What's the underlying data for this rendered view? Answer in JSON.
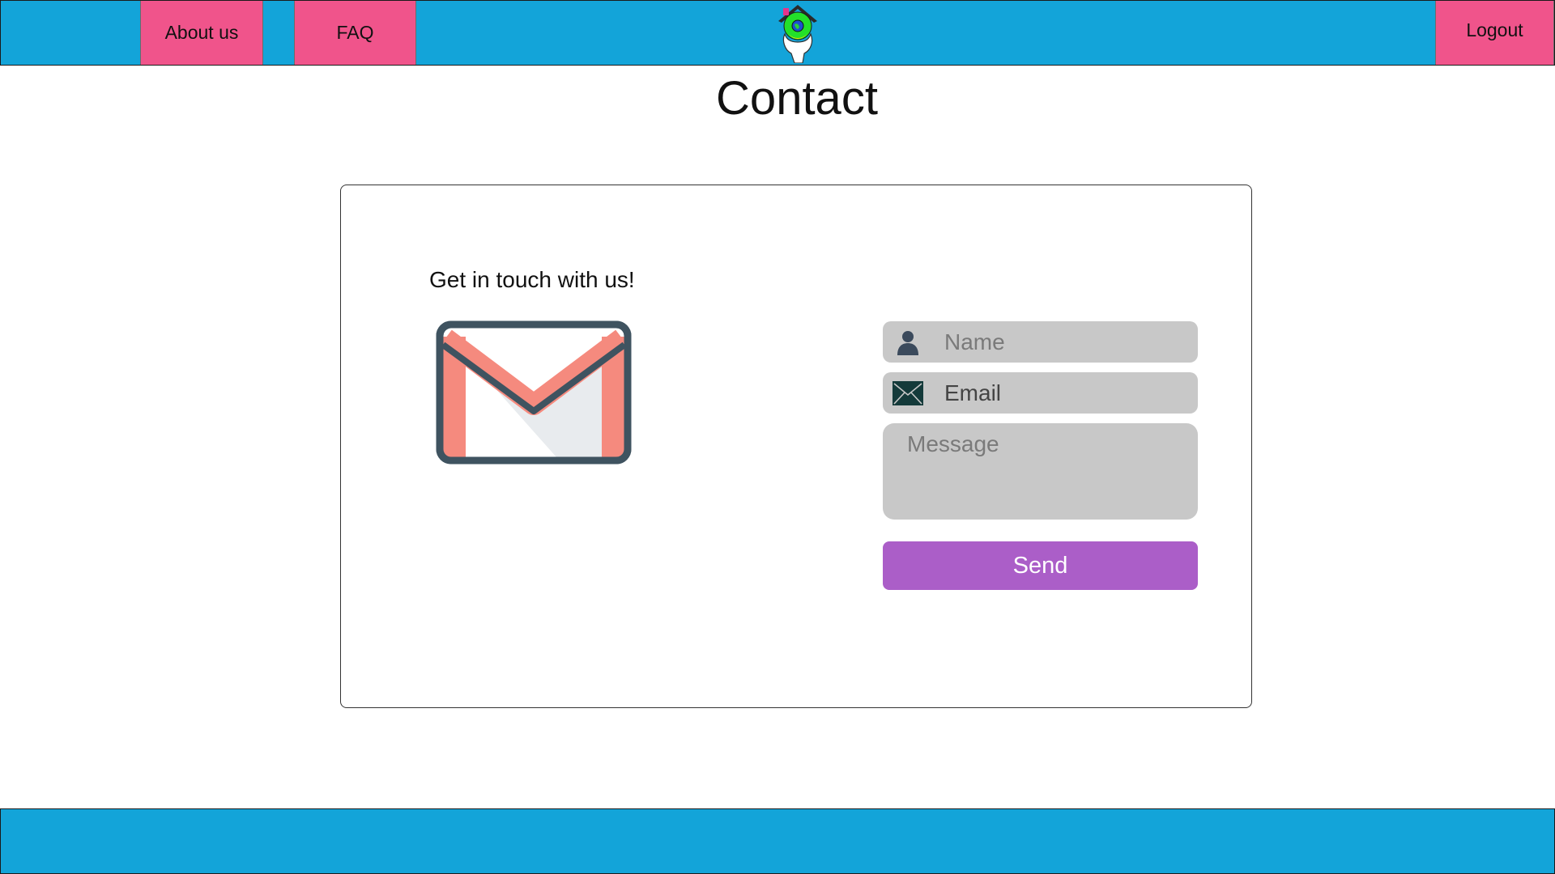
{
  "header": {
    "nav": {
      "about_label": "About us",
      "faq_label": "FAQ",
      "logout_label": "Logout"
    },
    "logo_icon": "house-in-hand-logo-icon"
  },
  "page_title": "Contact",
  "contact_card": {
    "heading": "Get in touch with us!",
    "graphic_icon": "gmail-envelope-icon"
  },
  "form": {
    "name_placeholder": "Name",
    "email_placeholder": "Email",
    "message_placeholder": "Message",
    "send_label": "Send",
    "icons": {
      "name": "user-icon",
      "email": "envelope-icon"
    }
  },
  "colors": {
    "header_bg": "#13a4d9",
    "nav_button_bg": "#f0548b",
    "field_bg": "#c8c8c8",
    "send_button_bg": "#ab5ec8"
  }
}
